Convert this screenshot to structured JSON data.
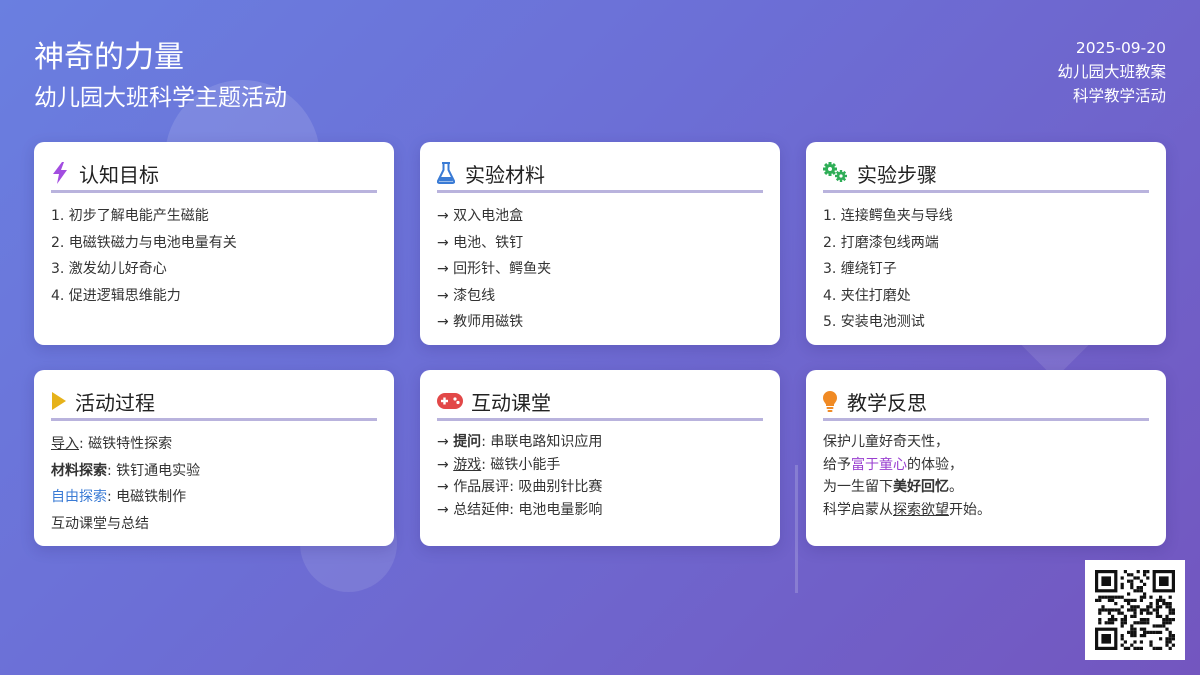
{
  "header": {
    "title": "神奇的力量",
    "subtitle": "幼儿园大班科学主题活动",
    "date": "2025-09-20",
    "meta_line1": "幼儿园大班教案",
    "meta_line2": "科学教学活动"
  },
  "colors": {
    "accent_underline": "#b9b3dd",
    "blue": "#3a7bd5",
    "purple": "#9a3fd0"
  },
  "cards": {
    "goals": {
      "icon": "lightning-icon",
      "title": "认知目标",
      "items": [
        "1. 初步了解电能产生磁能",
        "2. 电磁铁磁力与电池电量有关",
        "3. 激发幼儿好奇心",
        "4. 促进逻辑思维能力"
      ]
    },
    "materials": {
      "icon": "flask-icon",
      "title": "实验材料",
      "items": [
        "→ 双入电池盒",
        "→ 电池、铁钉",
        "→ 回形针、鳄鱼夹",
        "→ 漆包线",
        "→ 教师用磁铁"
      ]
    },
    "steps": {
      "icon": "gears-icon",
      "title": "实验步骤",
      "items": [
        "1. 连接鳄鱼夹与导线",
        "2. 打磨漆包线两端",
        "3. 缠绕钉子",
        "4. 夹住打磨处",
        "5. 安装电池测试"
      ]
    },
    "process": {
      "icon": "play-icon",
      "title": "活动过程",
      "items": [
        {
          "label": "导入",
          "text": ": 磁铁特性探索"
        },
        {
          "label": "材料探索",
          "text": ": 铁钉通电实验"
        },
        {
          "label": "自由探索",
          "text": ": 电磁铁制作"
        },
        {
          "label": "",
          "text": "互动课堂与总结"
        }
      ]
    },
    "interactive": {
      "icon": "gamepad-icon",
      "title": "互动课堂",
      "items": [
        {
          "prefix": "→ ",
          "label": "提问",
          "text": ": 串联电路知识应用"
        },
        {
          "prefix": "→ ",
          "label": "游戏",
          "text": ": 磁铁小能手"
        },
        {
          "prefix": "→ ",
          "label": "作品展评",
          "text": ": 吸曲别针比赛"
        },
        {
          "prefix": "→ ",
          "label": "总结延伸",
          "text": ": 电池电量影响"
        }
      ]
    },
    "reflection": {
      "icon": "lightbulb-icon",
      "title": "教学反思",
      "line1": "保护儿童好奇天性，",
      "line2_a": "给予",
      "line2_b": "富于童心",
      "line2_c": "的体验，",
      "line3_a": "为一生留下",
      "line3_b": "美好回忆",
      "line3_c": "。",
      "line4_a": "科学启蒙从",
      "line4_b": "探索欲望",
      "line4_c": "开始。"
    }
  },
  "qr": {
    "icon": "qr-code-icon"
  }
}
